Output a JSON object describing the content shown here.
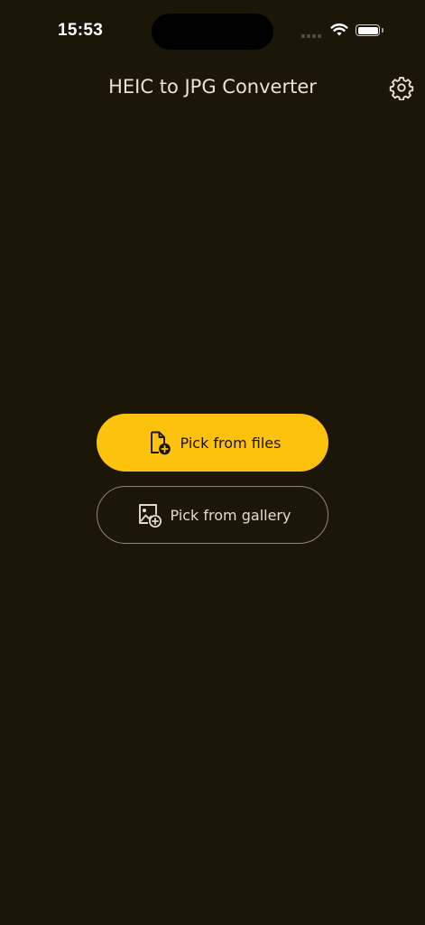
{
  "status_bar": {
    "time": "15:53"
  },
  "header": {
    "title": "HEIC to JPG Converter",
    "settings_icon": "gear-icon"
  },
  "actions": {
    "pick_files": {
      "label": "Pick from files",
      "icon": "file-add-icon"
    },
    "pick_gallery": {
      "label": "Pick from gallery",
      "icon": "image-add-icon"
    }
  },
  "colors": {
    "background": "#1c1608",
    "accent": "#fdc20c",
    "text": "#eae3d4",
    "outline": "#8e8677"
  }
}
